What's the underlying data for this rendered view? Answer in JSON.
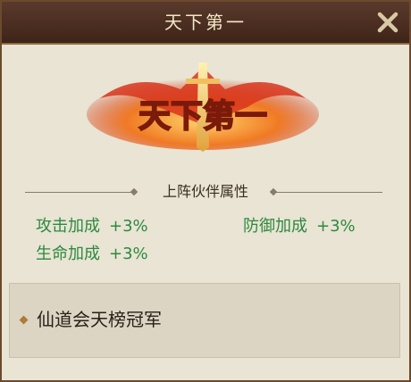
{
  "window": {
    "title": "天下第一"
  },
  "emblem": {
    "text": "天下第一"
  },
  "section": {
    "label": "上阵伙伴属性"
  },
  "stats": [
    {
      "name": "攻击加成",
      "value": "+3%"
    },
    {
      "name": "防御加成",
      "value": "+3%"
    },
    {
      "name": "生命加成",
      "value": "+3%"
    }
  ],
  "source": {
    "text": "仙道会天榜冠军"
  },
  "colors": {
    "stat_green": "#2c8a3e",
    "header_bg": "#4a2e22",
    "emblem_gold": "#f6d27a"
  }
}
